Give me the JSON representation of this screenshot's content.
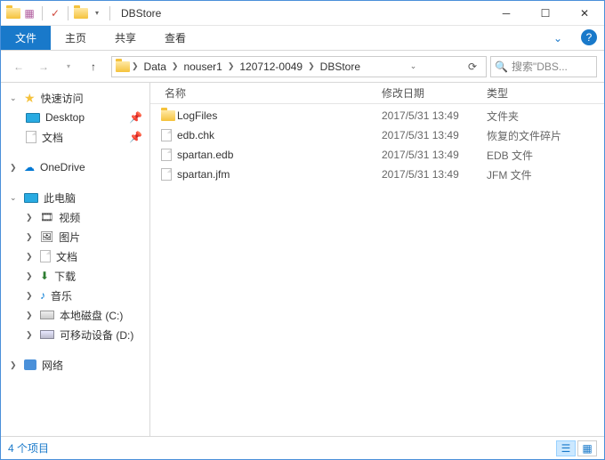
{
  "window": {
    "title": "DBStore"
  },
  "ribbon": {
    "file": "文件",
    "home": "主页",
    "share": "共享",
    "view": "查看"
  },
  "breadcrumb": [
    "Data",
    "nouser1",
    "120712-0049",
    "DBStore"
  ],
  "search": {
    "placeholder": "搜索\"DBS..."
  },
  "sidebar": {
    "quick": "快速访问",
    "desktop": "Desktop",
    "documents": "文档",
    "onedrive": "OneDrive",
    "thispc": "此电脑",
    "video": "视频",
    "pictures": "图片",
    "documents2": "文档",
    "downloads": "下载",
    "music": "音乐",
    "localdisk": "本地磁盘 (C:)",
    "removable": "可移动设备 (D:)",
    "network": "网络"
  },
  "columns": {
    "name": "名称",
    "modified": "修改日期",
    "type": "类型"
  },
  "files": [
    {
      "name": "LogFiles",
      "modified": "2017/5/31 13:49",
      "type": "文件夹",
      "icon": "folder"
    },
    {
      "name": "edb.chk",
      "modified": "2017/5/31 13:49",
      "type": "恢复的文件碎片",
      "icon": "file"
    },
    {
      "name": "spartan.edb",
      "modified": "2017/5/31 13:49",
      "type": "EDB 文件",
      "icon": "file"
    },
    {
      "name": "spartan.jfm",
      "modified": "2017/5/31 13:49",
      "type": "JFM 文件",
      "icon": "file"
    }
  ],
  "status": {
    "count": "4 个项目"
  }
}
